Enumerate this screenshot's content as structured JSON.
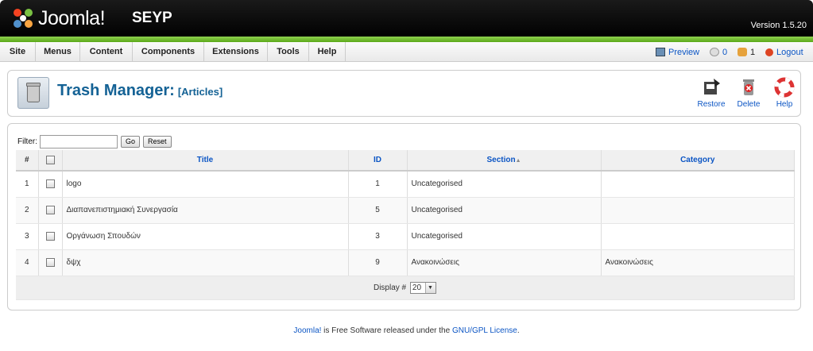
{
  "header": {
    "logo_text": "Joomla!",
    "site_name": "SEYP",
    "version": "Version 1.5.20"
  },
  "menu": {
    "items": [
      "Site",
      "Menus",
      "Content",
      "Components",
      "Extensions",
      "Tools",
      "Help"
    ]
  },
  "status": {
    "preview": "Preview",
    "messages": "0",
    "users": "1",
    "logout": "Logout"
  },
  "toolbar": {
    "title": "Trash Manager:",
    "subtitle": "[Articles]",
    "restore": "Restore",
    "delete": "Delete",
    "help": "Help"
  },
  "filter": {
    "label": "Filter:",
    "value": "",
    "go": "Go",
    "reset": "Reset"
  },
  "table": {
    "headers": [
      "#",
      "",
      "Title",
      "ID",
      "Section",
      "Category"
    ],
    "sort_arrow": "▲",
    "rows": [
      {
        "num": "1",
        "title": "logo",
        "id": "1",
        "section": "Uncategorised",
        "category": ""
      },
      {
        "num": "2",
        "title": "Διαπανεπιστημιακή Συνεργασία",
        "id": "5",
        "section": "Uncategorised",
        "category": ""
      },
      {
        "num": "3",
        "title": "Οργάνωση Σπουδών",
        "id": "3",
        "section": "Uncategorised",
        "category": ""
      },
      {
        "num": "4",
        "title": "δψχ",
        "id": "9",
        "section": "Ανακοινώσεις",
        "category": "Ανακοινώσεις"
      }
    ]
  },
  "pagination": {
    "label": "Display #",
    "value": "20"
  },
  "footer": {
    "joomla": "Joomla!",
    "middle": " is Free Software released under the ",
    "license": "GNU/GPL License",
    "end": "."
  }
}
